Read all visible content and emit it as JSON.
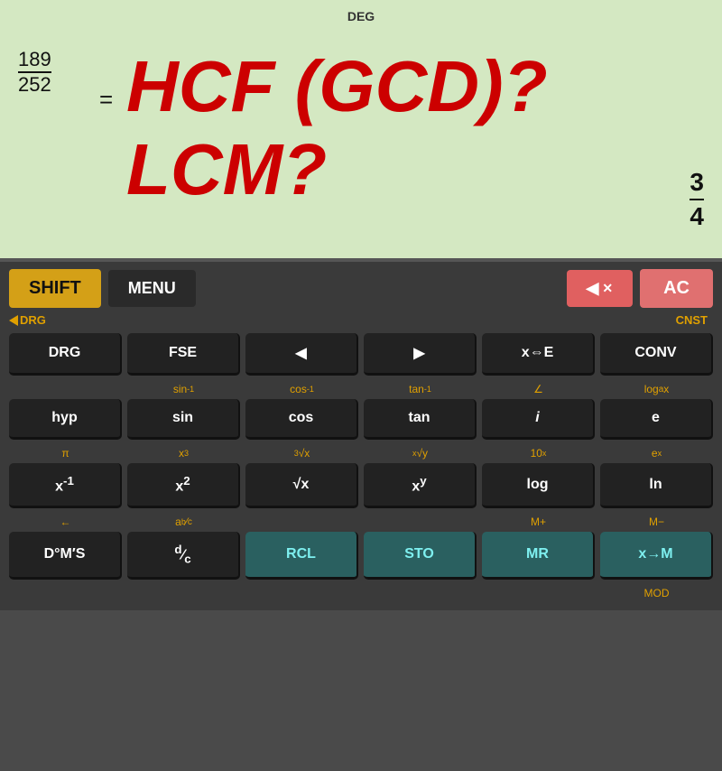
{
  "display": {
    "deg_label": "DEG",
    "fraction": {
      "numerator": "189",
      "denominator": "252"
    },
    "equals": "=",
    "main_text_line1": "HCF (GCD)?",
    "main_text_line2": "LCM?",
    "corner_fraction": {
      "top": "3",
      "bottom": "4"
    }
  },
  "keypad": {
    "row_top": {
      "shift": "SHIFT",
      "menu": "MENU",
      "backspace_symbol": "◀✕",
      "ac": "AC"
    },
    "sub_row1": {
      "left": "▶DRG",
      "right": "CNST"
    },
    "row1": [
      "DRG",
      "FSE",
      "◀",
      "▶",
      "x⇔E",
      "CONV"
    ],
    "sub_row2": [
      "",
      "sin⁻¹",
      "cos⁻¹",
      "tan⁻¹",
      "∠",
      "logₐ x"
    ],
    "row2": [
      "hyp",
      "sin",
      "cos",
      "tan",
      "i",
      "e"
    ],
    "sub_row3": [
      "π",
      "x³",
      "³√x",
      "ˣ√y",
      "10ˣ",
      "eˣ"
    ],
    "row3": [
      "x⁻¹",
      "x²",
      "√x",
      "xʸ",
      "log",
      "ln"
    ],
    "sub_row4": [
      "←",
      "a b/c",
      "",
      "",
      "M+",
      "M−"
    ],
    "row4": [
      "D°M′S",
      "d/c",
      "RCL",
      "STO",
      "MR",
      "x→M"
    ],
    "sub_row5": [
      "",
      "",
      "",
      "",
      "",
      "MOD"
    ]
  }
}
